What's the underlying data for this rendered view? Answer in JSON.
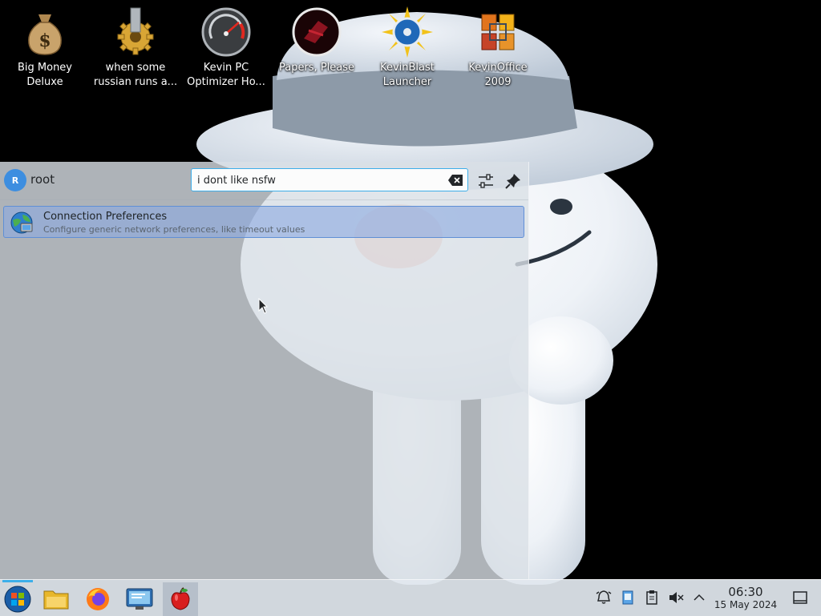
{
  "desktop": {
    "icons": [
      {
        "name": "big-money-deluxe",
        "label": "Big Money\nDeluxe",
        "icon": "money-bag-icon"
      },
      {
        "name": "when-some-russian",
        "label": "when some\nrussian runs a...",
        "icon": "gear-icon"
      },
      {
        "name": "kevin-pc-optimizer",
        "label": "Kevin PC\nOptimizer Ho...",
        "icon": "speedometer-icon"
      },
      {
        "name": "papers-please",
        "label": "Papers, Please",
        "icon": "papers-please-icon"
      },
      {
        "name": "kevinblast-launcher",
        "label": "KevinBlast\nLauncher",
        "icon": "sunburst-disc-icon"
      },
      {
        "name": "kevinoffice-2009",
        "label": "KevinOffice\n2009",
        "icon": "office-icon"
      }
    ]
  },
  "launcher": {
    "user_initial": "R",
    "username": "root",
    "search_value": "i dont like nsfw",
    "results": [
      {
        "title": "Connection Preferences",
        "description": "Configure generic network preferences, like timeout values",
        "icon": "network-globe-icon"
      }
    ]
  },
  "taskbar": {
    "apps": [
      "start-menu",
      "file-manager",
      "firefox",
      "system-monitor",
      "red-apple-app"
    ],
    "clock_time": "06:30",
    "clock_date": "15 May 2024"
  },
  "colors": {
    "accent": "#3daee9",
    "selection": "#5f8fd6",
    "avatar": "#3d8ee0"
  }
}
